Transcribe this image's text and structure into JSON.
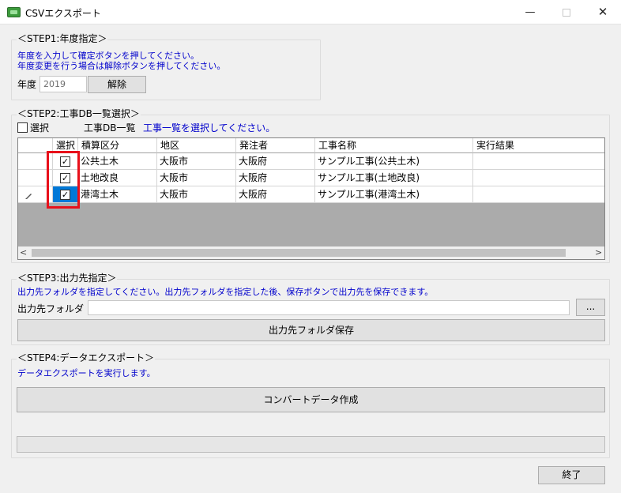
{
  "window": {
    "title": "CSVエクスポート",
    "minimize_glyph": "—",
    "close_glyph": "✕"
  },
  "step1": {
    "legend": "＜STEP1:年度指定＞",
    "instruction_line1": "年度を入力して確定ボタンを押してください。",
    "instruction_line2": "年度変更を行う場合は解除ボタンを押してください。",
    "year_label": "年度",
    "year_value": "2019",
    "release_button": "解除"
  },
  "step2": {
    "legend": "＜STEP2:工事DB一覧選択＞",
    "select_all_label": "選択",
    "db_list_label": "工事DB一覧",
    "instruction": "工事一覧を選択してください。",
    "columns": [
      "選択",
      "積算区分",
      "地区",
      "発注者",
      "工事名称",
      "実行結果"
    ],
    "rows": [
      {
        "checked": true,
        "category": "公共土木",
        "district": "大阪市",
        "orderer": "大阪府",
        "name": "サンプル工事(公共土木)",
        "result": ""
      },
      {
        "checked": true,
        "category": "土地改良",
        "district": "大阪市",
        "orderer": "大阪府",
        "name": "サンプル工事(土地改良)",
        "result": ""
      },
      {
        "checked": true,
        "category": "港湾土木",
        "district": "大阪市",
        "orderer": "大阪府",
        "name": "サンプル工事(港湾土木)",
        "result": ""
      }
    ],
    "check_glyph": "✓",
    "scroll_left": "<",
    "scroll_right": ">"
  },
  "step3": {
    "legend": "＜STEP3:出力先指定＞",
    "instruction": "出力先フォルダを指定してください。出力先フォルダを指定した後、保存ボタンで出力先を保存できます。",
    "folder_label": "出力先フォルダ",
    "folder_value": "",
    "browse_button": "...",
    "save_button": "出力先フォルダ保存"
  },
  "step4": {
    "legend": "＜STEP4:データエクスポート＞",
    "instruction": "データエクスポートを実行します。",
    "convert_button": "コンバートデータ作成",
    "progress": 0
  },
  "footer": {
    "exit_button": "終了"
  },
  "colors": {
    "highlight": "#e8101a",
    "selection": "#0078d7",
    "instruction_text": "#0000cc"
  }
}
